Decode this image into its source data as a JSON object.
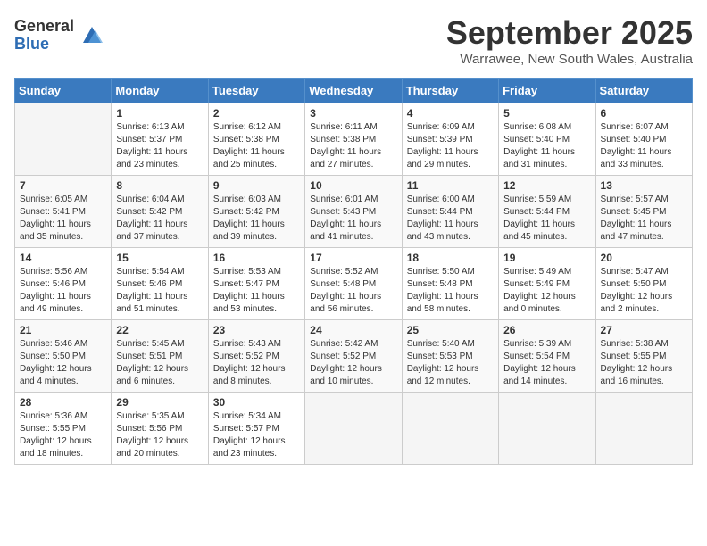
{
  "logo": {
    "general": "General",
    "blue": "Blue"
  },
  "title": "September 2025",
  "subtitle": "Warrawee, New South Wales, Australia",
  "days_of_week": [
    "Sunday",
    "Monday",
    "Tuesday",
    "Wednesday",
    "Thursday",
    "Friday",
    "Saturday"
  ],
  "weeks": [
    [
      {
        "day": "",
        "sunrise": "",
        "sunset": "",
        "daylight": ""
      },
      {
        "day": "1",
        "sunrise": "Sunrise: 6:13 AM",
        "sunset": "Sunset: 5:37 PM",
        "daylight": "Daylight: 11 hours and 23 minutes."
      },
      {
        "day": "2",
        "sunrise": "Sunrise: 6:12 AM",
        "sunset": "Sunset: 5:38 PM",
        "daylight": "Daylight: 11 hours and 25 minutes."
      },
      {
        "day": "3",
        "sunrise": "Sunrise: 6:11 AM",
        "sunset": "Sunset: 5:38 PM",
        "daylight": "Daylight: 11 hours and 27 minutes."
      },
      {
        "day": "4",
        "sunrise": "Sunrise: 6:09 AM",
        "sunset": "Sunset: 5:39 PM",
        "daylight": "Daylight: 11 hours and 29 minutes."
      },
      {
        "day": "5",
        "sunrise": "Sunrise: 6:08 AM",
        "sunset": "Sunset: 5:40 PM",
        "daylight": "Daylight: 11 hours and 31 minutes."
      },
      {
        "day": "6",
        "sunrise": "Sunrise: 6:07 AM",
        "sunset": "Sunset: 5:40 PM",
        "daylight": "Daylight: 11 hours and 33 minutes."
      }
    ],
    [
      {
        "day": "7",
        "sunrise": "Sunrise: 6:05 AM",
        "sunset": "Sunset: 5:41 PM",
        "daylight": "Daylight: 11 hours and 35 minutes."
      },
      {
        "day": "8",
        "sunrise": "Sunrise: 6:04 AM",
        "sunset": "Sunset: 5:42 PM",
        "daylight": "Daylight: 11 hours and 37 minutes."
      },
      {
        "day": "9",
        "sunrise": "Sunrise: 6:03 AM",
        "sunset": "Sunset: 5:42 PM",
        "daylight": "Daylight: 11 hours and 39 minutes."
      },
      {
        "day": "10",
        "sunrise": "Sunrise: 6:01 AM",
        "sunset": "Sunset: 5:43 PM",
        "daylight": "Daylight: 11 hours and 41 minutes."
      },
      {
        "day": "11",
        "sunrise": "Sunrise: 6:00 AM",
        "sunset": "Sunset: 5:44 PM",
        "daylight": "Daylight: 11 hours and 43 minutes."
      },
      {
        "day": "12",
        "sunrise": "Sunrise: 5:59 AM",
        "sunset": "Sunset: 5:44 PM",
        "daylight": "Daylight: 11 hours and 45 minutes."
      },
      {
        "day": "13",
        "sunrise": "Sunrise: 5:57 AM",
        "sunset": "Sunset: 5:45 PM",
        "daylight": "Daylight: 11 hours and 47 minutes."
      }
    ],
    [
      {
        "day": "14",
        "sunrise": "Sunrise: 5:56 AM",
        "sunset": "Sunset: 5:46 PM",
        "daylight": "Daylight: 11 hours and 49 minutes."
      },
      {
        "day": "15",
        "sunrise": "Sunrise: 5:54 AM",
        "sunset": "Sunset: 5:46 PM",
        "daylight": "Daylight: 11 hours and 51 minutes."
      },
      {
        "day": "16",
        "sunrise": "Sunrise: 5:53 AM",
        "sunset": "Sunset: 5:47 PM",
        "daylight": "Daylight: 11 hours and 53 minutes."
      },
      {
        "day": "17",
        "sunrise": "Sunrise: 5:52 AM",
        "sunset": "Sunset: 5:48 PM",
        "daylight": "Daylight: 11 hours and 56 minutes."
      },
      {
        "day": "18",
        "sunrise": "Sunrise: 5:50 AM",
        "sunset": "Sunset: 5:48 PM",
        "daylight": "Daylight: 11 hours and 58 minutes."
      },
      {
        "day": "19",
        "sunrise": "Sunrise: 5:49 AM",
        "sunset": "Sunset: 5:49 PM",
        "daylight": "Daylight: 12 hours and 0 minutes."
      },
      {
        "day": "20",
        "sunrise": "Sunrise: 5:47 AM",
        "sunset": "Sunset: 5:50 PM",
        "daylight": "Daylight: 12 hours and 2 minutes."
      }
    ],
    [
      {
        "day": "21",
        "sunrise": "Sunrise: 5:46 AM",
        "sunset": "Sunset: 5:50 PM",
        "daylight": "Daylight: 12 hours and 4 minutes."
      },
      {
        "day": "22",
        "sunrise": "Sunrise: 5:45 AM",
        "sunset": "Sunset: 5:51 PM",
        "daylight": "Daylight: 12 hours and 6 minutes."
      },
      {
        "day": "23",
        "sunrise": "Sunrise: 5:43 AM",
        "sunset": "Sunset: 5:52 PM",
        "daylight": "Daylight: 12 hours and 8 minutes."
      },
      {
        "day": "24",
        "sunrise": "Sunrise: 5:42 AM",
        "sunset": "Sunset: 5:52 PM",
        "daylight": "Daylight: 12 hours and 10 minutes."
      },
      {
        "day": "25",
        "sunrise": "Sunrise: 5:40 AM",
        "sunset": "Sunset: 5:53 PM",
        "daylight": "Daylight: 12 hours and 12 minutes."
      },
      {
        "day": "26",
        "sunrise": "Sunrise: 5:39 AM",
        "sunset": "Sunset: 5:54 PM",
        "daylight": "Daylight: 12 hours and 14 minutes."
      },
      {
        "day": "27",
        "sunrise": "Sunrise: 5:38 AM",
        "sunset": "Sunset: 5:55 PM",
        "daylight": "Daylight: 12 hours and 16 minutes."
      }
    ],
    [
      {
        "day": "28",
        "sunrise": "Sunrise: 5:36 AM",
        "sunset": "Sunset: 5:55 PM",
        "daylight": "Daylight: 12 hours and 18 minutes."
      },
      {
        "day": "29",
        "sunrise": "Sunrise: 5:35 AM",
        "sunset": "Sunset: 5:56 PM",
        "daylight": "Daylight: 12 hours and 20 minutes."
      },
      {
        "day": "30",
        "sunrise": "Sunrise: 5:34 AM",
        "sunset": "Sunset: 5:57 PM",
        "daylight": "Daylight: 12 hours and 23 minutes."
      },
      {
        "day": "",
        "sunrise": "",
        "sunset": "",
        "daylight": ""
      },
      {
        "day": "",
        "sunrise": "",
        "sunset": "",
        "daylight": ""
      },
      {
        "day": "",
        "sunrise": "",
        "sunset": "",
        "daylight": ""
      },
      {
        "day": "",
        "sunrise": "",
        "sunset": "",
        "daylight": ""
      }
    ]
  ]
}
